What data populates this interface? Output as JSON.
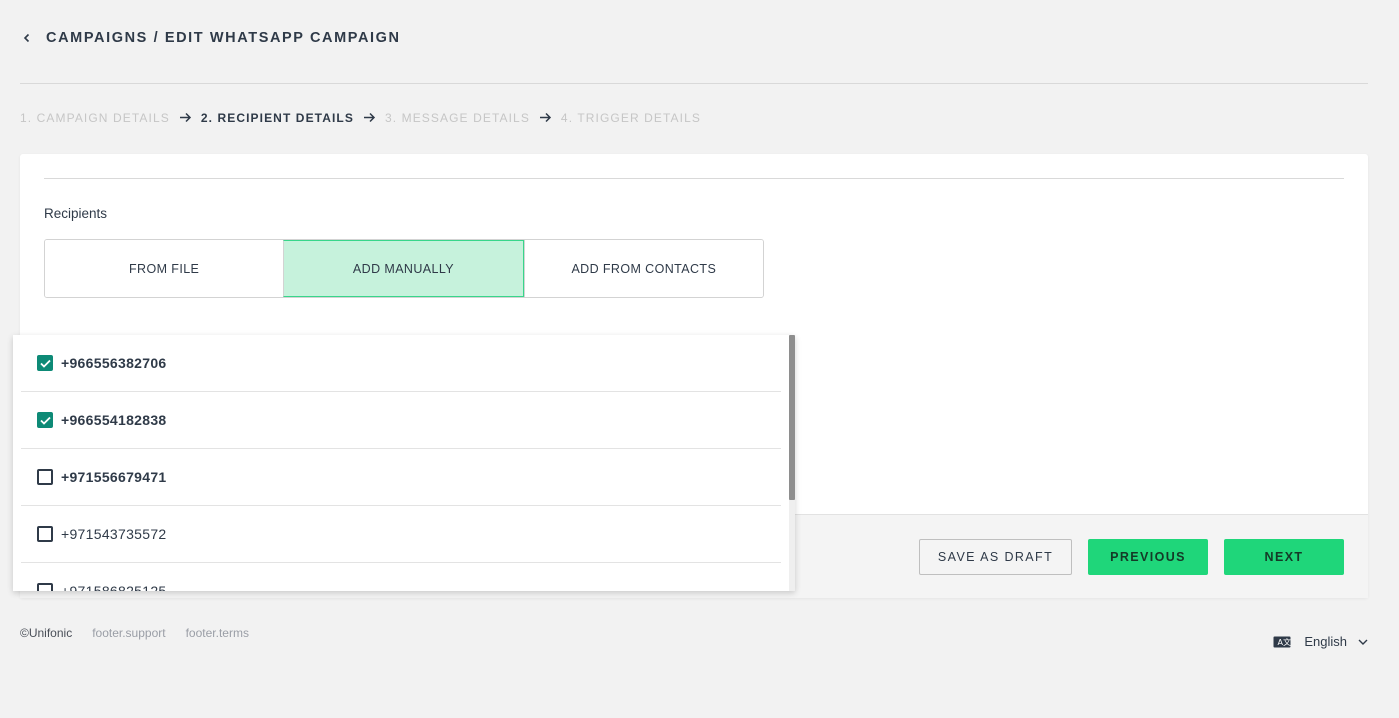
{
  "header": {
    "title": "CAMPAIGNS / EDIT WHATSAPP CAMPAIGN"
  },
  "steps": [
    {
      "label": "1. CAMPAIGN DETAILS",
      "state": "inactive"
    },
    {
      "label": "2. RECIPIENT DETAILS",
      "state": "active"
    },
    {
      "label": "3. MESSAGE DETAILS",
      "state": "inactive"
    },
    {
      "label": "4. TRIGGER DETAILS",
      "state": "inactive"
    }
  ],
  "recipients": {
    "label": "Recipients",
    "tabs": [
      {
        "label": "FROM FILE",
        "active": false
      },
      {
        "label": "ADD MANUALLY",
        "active": true
      },
      {
        "label": "ADD FROM CONTACTS",
        "active": false
      }
    ]
  },
  "dropdown": {
    "items": [
      {
        "number": "+966556382706",
        "checked": true,
        "bold": true
      },
      {
        "number": "+966554182838",
        "checked": true,
        "bold": true
      },
      {
        "number": "+971556679471",
        "checked": false,
        "bold": true
      },
      {
        "number": "+971543735572",
        "checked": false,
        "bold": false
      },
      {
        "number": "+971586825125",
        "checked": false,
        "bold": false
      }
    ]
  },
  "actions": {
    "save_draft": "SAVE AS DRAFT",
    "previous": "PREVIOUS",
    "next": "NEXT"
  },
  "footer": {
    "copyright": "©Unifonic",
    "support": "footer.support",
    "terms": "footer.terms",
    "language": "English"
  },
  "colors": {
    "accent": "#1fd67a",
    "tab_active_bg": "#c6f2dc",
    "checkbox_checked": "#0d8a76"
  }
}
